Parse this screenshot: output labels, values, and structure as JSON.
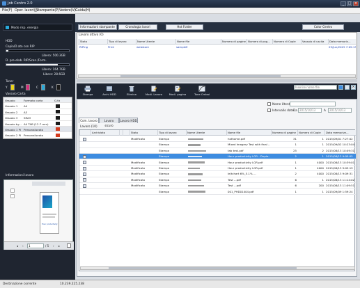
{
  "window": {
    "title": "Job Centro 2.0",
    "controls": [
      "_",
      "□",
      "×"
    ]
  },
  "menu": [
    "File(F)",
    "Oper. lavori(J)",
    "Stampante(P)",
    "Vedere(V)",
    "Guida(H)"
  ],
  "left": {
    "power_mode": "Modo risp. energia",
    "hdd_title": "HDD",
    "hdd_copy_label": "Copia/D.ata con RIP",
    "hdd_copy_free": "Libero: 500.3GB",
    "hdd_copy_fill": 0.03,
    "hdd_scan_label": "D. pre-elab. RIP/Scan./Form.",
    "hdd_scan_free": "Libero: 164.7GB",
    "hdd_scan_total": "Libero: 28.6GB",
    "hdd_scan_fill": 0.82,
    "toner_title": "Toner",
    "toners": [
      {
        "label": "Y",
        "color": "#e8d21a"
      },
      {
        "label": "M",
        "color": "#d4307a"
      },
      {
        "label": "C",
        "color": "#2aa9d9"
      },
      {
        "label": "K",
        "color": "#1a1a1a"
      }
    ],
    "trays_title": "Vassoio Carta",
    "tray_headers": [
      "Vassoio",
      "Formato carta",
      "Q.tà"
    ],
    "trays": [
      {
        "name": "Vassoio 1",
        "size": "A4",
        "qty_color": "#1a1a1a",
        "highlight": false
      },
      {
        "name": "Vassoio 2",
        "size": "A3",
        "qty_color": "#1a1a1a",
        "highlight": false
      },
      {
        "name": "Vassoio 3",
        "size": "SRA3",
        "qty_color": "#1a1a1a",
        "highlight": false
      },
      {
        "name": "Vassoio by...",
        "size": "A4 TAB (12.7 mm)",
        "qty_color": "#1a1a1a",
        "highlight": false
      },
      {
        "name": "Vassoio 1 PI",
        "size": "Personalizzato",
        "qty_color": "#d33b1e",
        "highlight": true
      },
      {
        "name": "Vassoio 2 PI",
        "size": "Personalizzato",
        "qty_color": "#d33b1e",
        "highlight": false
      }
    ],
    "job_info_title": "Informazioni lavoro",
    "page_current": "1",
    "page_total": "/ 5",
    "preview_text": "Hour productivity"
  },
  "toolbar": {
    "buttons": [
      "Informazioni stampante",
      "Cronologia lavori",
      "Hot Folder",
      "Color Centro"
    ]
  },
  "active_jobs": {
    "title": "Lavoro attivo (0)",
    "headers": [
      "Stato",
      "Tipo di lavoro",
      "Nome Utente",
      "Nome file",
      "Numero di pagine",
      "Numero di pag...",
      "Numero di Copie",
      "Vassoio di uscita",
      "Data memoriz..."
    ],
    "row": [
      "RIPing",
      "Print",
      "webstore",
      "sampleE",
      "",
      "",
      "",
      "",
      "29/Jun/2025 7:05:13"
    ]
  },
  "job_toolbar": {
    "buttons": [
      "Stampa",
      "Archi HDD",
      "Elimina",
      "Modi. Lavoro",
      "Modi. pagina",
      "Tone Cmbai"
    ],
    "search_placeholder": "Inserire nome file"
  },
  "filters": {
    "user_label": "Nome Utente",
    "date_label": "Intervallo date",
    "da_label": "Da",
    "a_label": "A",
    "date_from": "2015/10/13",
    "date_to": "2015/10/13"
  },
  "tabs": [
    "Com. lavoro",
    "Lavoro sicuro",
    "Lavoro HDD"
  ],
  "history": {
    "title": "Lavoro (10)",
    "headers": [
      "Archiviato",
      "",
      "",
      "Stato",
      "Tipo di lavoro",
      "Nome Utente",
      "Nome file",
      "Numero di pagine",
      "Numero di Copie",
      "Data memorizz..."
    ],
    "rows": [
      {
        "archived": true,
        "status": "Modificato",
        "type": "Stampa",
        "user": true,
        "file": "hothome.pdf",
        "pages": "31",
        "copies": "1",
        "date": "2015/09/01 7:27:02",
        "selected": false
      },
      {
        "archived": false,
        "status": "",
        "type": "Stampa",
        "user": true,
        "file": "Mixed Imagery Test with final ...",
        "pages": "1",
        "copies": "1",
        "date": "2015/09/02 10:23:04",
        "selected": false
      },
      {
        "archived": false,
        "status": "",
        "type": "Stampa",
        "user": true,
        "file": "tab test.pdf",
        "pages": "25",
        "copies": "2",
        "date": "2015/08/13 10:49:31",
        "selected": false
      },
      {
        "archived": true,
        "status": "",
        "type": "Stampa",
        "user": true,
        "file": "Hour productivity LGR - Duple...",
        "pages": "2",
        "copies": "1",
        "date": "2015/08/13 9:05:05",
        "selected": true
      },
      {
        "archived": true,
        "status": "Modificato",
        "type": "Stampa",
        "user": true,
        "file": "Hour productivity LGR.pdf",
        "pages": "1",
        "copies": "4000",
        "date": "2015/08/13 10:39:01",
        "selected": false
      },
      {
        "archived": true,
        "status": "Modificato",
        "type": "Stampa",
        "user": true,
        "file": "Hour productivity LGR.pdf",
        "pages": "1",
        "copies": "4000",
        "date": "2015/08/13 9:05:19",
        "selected": false
      },
      {
        "archived": true,
        "status": "Modificato",
        "type": "Stampa",
        "user": true,
        "file": "Ie/tchart 6%_5.1% ...",
        "pages": "2",
        "copies": "4000",
        "date": "2015/08/13 9:09:31",
        "selected": false
      },
      {
        "archived": true,
        "status": "Modificato",
        "type": "Stampa",
        "user": true,
        "file": "Test ...pdf",
        "pages": "6",
        "copies": "1",
        "date": "2015/08/13 11:14:02",
        "selected": false
      },
      {
        "archived": true,
        "status": "Modificato",
        "type": "Stampa",
        "user": true,
        "file": "Test ...pdf",
        "pages": "6",
        "copies": "200",
        "date": "2015/08/13 11:09:51",
        "selected": false
      },
      {
        "archived": false,
        "status": "",
        "type": "Stampa",
        "user": true,
        "file": "001_PHD01404.pdf",
        "pages": "1",
        "copies": "1",
        "date": "2015/09/09 1:59:24",
        "selected": false
      }
    ]
  },
  "status": {
    "label": "Destinazione corrente",
    "value": "10.239.225.238"
  }
}
